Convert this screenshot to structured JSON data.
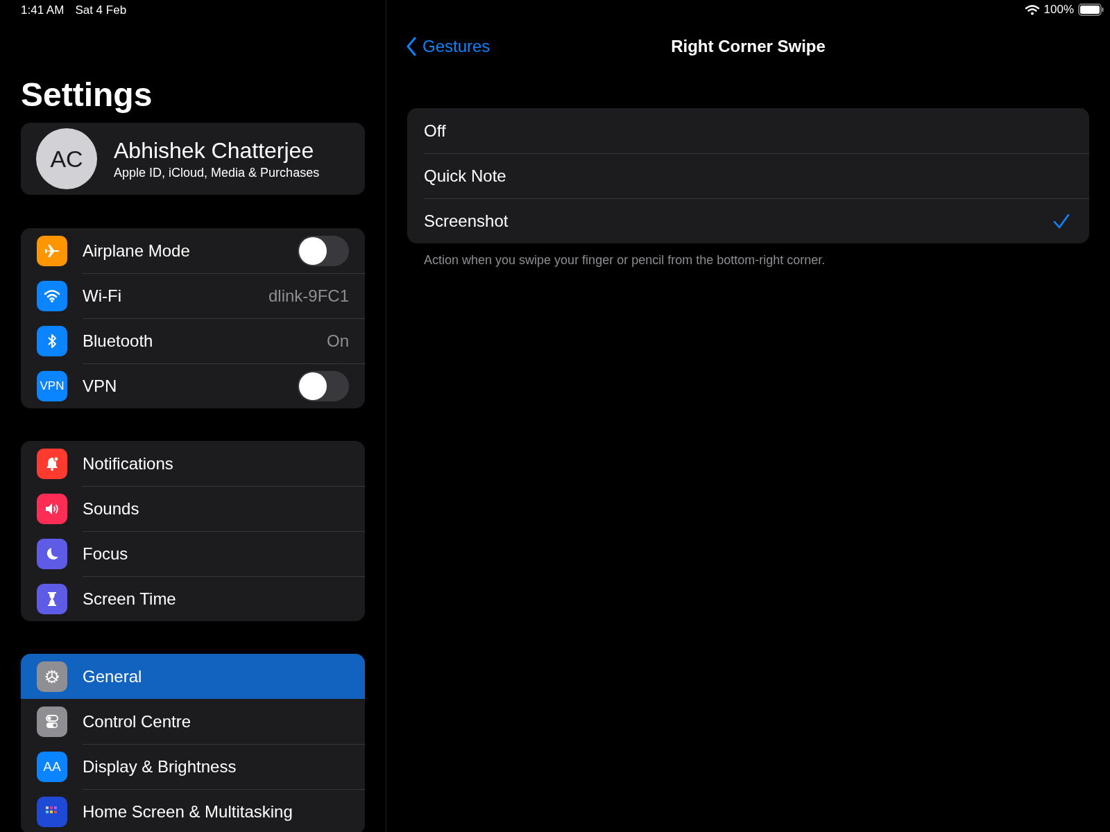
{
  "status_bar": {
    "time": "1:41 AM",
    "date": "Sat 4 Feb",
    "battery": "100%"
  },
  "sidebar": {
    "title": "Settings",
    "profile": {
      "initials": "AC",
      "name": "Abhishek Chatterjee",
      "subtitle": "Apple ID, iCloud, Media & Purchases"
    },
    "groups": [
      [
        {
          "kind": "toggle",
          "label": "Airplane Mode",
          "on": false,
          "selected": false
        },
        {
          "kind": "value",
          "label": "Wi-Fi",
          "value": "dlink-9FC1",
          "selected": false
        },
        {
          "kind": "value",
          "label": "Bluetooth",
          "value": "On",
          "selected": false
        },
        {
          "kind": "toggle",
          "icon_text": "VPN",
          "label": "VPN",
          "on": false,
          "selected": false
        }
      ],
      [
        {
          "kind": "link",
          "label": "Notifications",
          "selected": false
        },
        {
          "kind": "link",
          "label": "Sounds",
          "selected": false
        },
        {
          "kind": "link",
          "label": "Focus",
          "selected": false
        },
        {
          "kind": "link",
          "label": "Screen Time",
          "selected": false
        }
      ],
      [
        {
          "kind": "link",
          "label": "General",
          "selected": true
        },
        {
          "kind": "link",
          "label": "Control Centre",
          "selected": false
        },
        {
          "kind": "link",
          "icon_text": "AA",
          "label": "Display & Brightness",
          "selected": false
        },
        {
          "kind": "link",
          "label": "Home Screen & Multitasking",
          "selected": false
        }
      ]
    ]
  },
  "detail": {
    "back": "Gestures",
    "title": "Right Corner Swipe",
    "options": [
      {
        "label": "Off",
        "selected": false
      },
      {
        "label": "Quick Note",
        "selected": false
      },
      {
        "label": "Screenshot",
        "selected": true
      }
    ],
    "footer": "Action when you swipe your finger or pencil from the bottom-right corner."
  }
}
